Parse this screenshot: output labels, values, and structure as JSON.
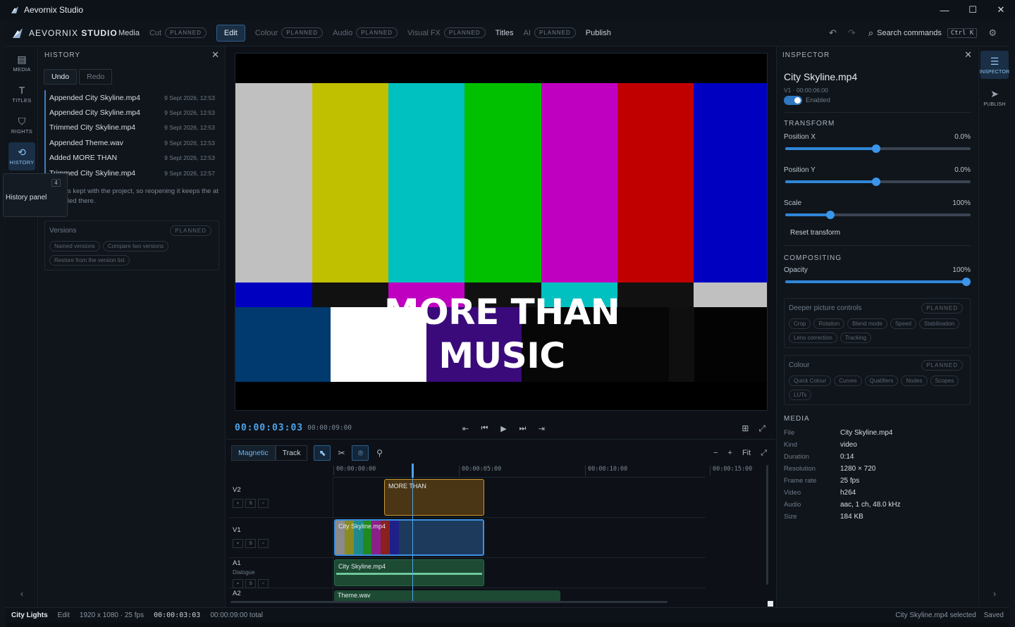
{
  "window": {
    "title": "Aevornix Studio",
    "minimize": "—",
    "maximize": "☐",
    "close": "✕"
  },
  "brand": {
    "prefix": "AEVORNIX",
    "suffix": "STUDIO"
  },
  "nav": [
    {
      "label": "Media",
      "badge": "",
      "state": "normal"
    },
    {
      "label": "Cut",
      "badge": "PLANNED",
      "state": "dim"
    },
    {
      "label": "Edit",
      "badge": "",
      "state": "active"
    },
    {
      "label": "Colour",
      "badge": "PLANNED",
      "state": "dim"
    },
    {
      "label": "Audio",
      "badge": "PLANNED",
      "state": "dim"
    },
    {
      "label": "Visual FX",
      "badge": "PLANNED",
      "state": "dim"
    },
    {
      "label": "Titles",
      "badge": "",
      "state": "normal"
    },
    {
      "label": "AI",
      "badge": "PLANNED",
      "state": "dim"
    },
    {
      "label": "Publish",
      "badge": "",
      "state": "normal"
    }
  ],
  "header": {
    "undo_icon": "↶",
    "redo_icon": "↷",
    "search_icon": "⌕",
    "search_label": "Search commands",
    "search_kbd": "Ctrl K",
    "settings_icon": "⚙"
  },
  "rail": [
    {
      "label": "MEDIA",
      "icon": "media-icon",
      "glyph": "▤"
    },
    {
      "label": "TITLES",
      "icon": "titles-icon",
      "glyph": "T"
    },
    {
      "label": "RIGHTS",
      "icon": "shield-icon",
      "glyph": "⛉"
    },
    {
      "label": "HISTORY",
      "icon": "history-icon",
      "glyph": "⟲"
    }
  ],
  "rail_bottom": "‹",
  "tooltip": {
    "kbd": "4",
    "text": "History panel"
  },
  "history": {
    "title": "HISTORY",
    "close": "✕",
    "undo": "Undo",
    "redo": "Redo",
    "items": [
      {
        "label": "Appended City Skyline.mp4",
        "time": "9 Sept 2026, 12:53"
      },
      {
        "label": "Appended City Skyline.mp4",
        "time": "9 Sept 2026, 12:53"
      },
      {
        "label": "Trimmed City Skyline.mp4",
        "time": "9 Sept 2026, 12:53"
      },
      {
        "label": "Appended Theme.wav",
        "time": "9 Sept 2026, 12:53"
      },
      {
        "label": "Added MORE THAN",
        "time": "9 Sept 2026, 12:53"
      },
      {
        "label": "Trimmed City Skyline.mp4",
        "time": "9 Sept 2026, 12:57"
      }
    ],
    "note": "s kept with the project, so reopening it keeps the at led there.",
    "versions": {
      "title": "Versions",
      "badge": "PLANNED",
      "pills": [
        "Named versions",
        "Compare two versions",
        "Restore from the version list"
      ]
    }
  },
  "viewer": {
    "title_line1": "MORE THAN",
    "title_line2": "MUSIC"
  },
  "transport": {
    "timecode": "00:00:03:03",
    "duration": "00:00:09:00",
    "controls": [
      "⇤",
      "⏮",
      "▶",
      "⏭",
      "⇥"
    ],
    "right": [
      "⊞",
      "⤢"
    ]
  },
  "timeline_toolbar": {
    "modes": [
      "Magnetic",
      "Track"
    ],
    "tools": [
      {
        "name": "select-tool-icon",
        "glyph": "⬉",
        "on": true
      },
      {
        "name": "razor-tool-icon",
        "glyph": "✂",
        "on": false
      },
      {
        "name": "snap-tool-icon",
        "glyph": "⌾",
        "on": true
      },
      {
        "name": "marker-tool-icon",
        "glyph": "⚲",
        "on": false
      }
    ],
    "zoom": [
      "−",
      "+",
      "Fit",
      "⤢"
    ]
  },
  "ruler": [
    "00:00:00:00",
    "00:00:05:00",
    "00:00:10:00",
    "00:00:15:00"
  ],
  "tracks": [
    {
      "name": "V2",
      "sub": "",
      "buttons": [
        "▪",
        "S",
        "▫"
      ]
    },
    {
      "name": "V1",
      "sub": "",
      "buttons": [
        "▪",
        "S",
        "▫"
      ]
    },
    {
      "name": "A1",
      "sub": "Dialogue",
      "buttons": [
        "▪",
        "S",
        "▫"
      ]
    },
    {
      "name": "A2",
      "sub": "",
      "buttons": []
    }
  ],
  "clips": {
    "v2": "MORE THAN",
    "v1": "City Skyline.mp4",
    "a1": "City Skyline.mp4",
    "a2": "Theme.wav"
  },
  "inspector": {
    "title": "INSPECTOR",
    "close": "✕",
    "clip_name": "City Skyline.mp4",
    "clip_meta": "V1 · 00:00:06:00",
    "enabled": "Enabled",
    "transform_title": "TRANSFORM",
    "position_x": {
      "label": "Position X",
      "value": "0.0%",
      "fraction": 0.5
    },
    "position_y": {
      "label": "Position Y",
      "value": "0.0%",
      "fraction": 0.5
    },
    "scale": {
      "label": "Scale",
      "value": "100%",
      "fraction": 0.25
    },
    "reset": "Reset transform",
    "compositing_title": "COMPOSITING",
    "opacity": {
      "label": "Opacity",
      "value": "100%",
      "fraction": 1.0
    },
    "deeper": {
      "title": "Deeper picture controls",
      "badge": "PLANNED",
      "pills": [
        "Crop",
        "Rotation",
        "Blend mode",
        "Speed",
        "Stabilisation",
        "Lens correction",
        "Tracking"
      ]
    },
    "colour": {
      "title": "Colour",
      "badge": "PLANNED",
      "pills": [
        "Quick Colour",
        "Curves",
        "Qualifiers",
        "Nodes",
        "Scopes",
        "LUTs"
      ]
    },
    "media_title": "MEDIA",
    "media": [
      {
        "k": "File",
        "v": "City Skyline.mp4"
      },
      {
        "k": "Kind",
        "v": "video"
      },
      {
        "k": "Duration",
        "v": "0:14"
      },
      {
        "k": "Resolution",
        "v": "1280 × 720"
      },
      {
        "k": "Frame rate",
        "v": "25 fps"
      },
      {
        "k": "Video",
        "v": "h264"
      },
      {
        "k": "Audio",
        "v": "aac, 1 ch, 48.0 kHz"
      },
      {
        "k": "Size",
        "v": "184 KB"
      }
    ]
  },
  "right_rail": [
    {
      "label": "INSPECTOR",
      "glyph": "☰"
    },
    {
      "label": "PUBLISH",
      "glyph": "➤"
    }
  ],
  "right_rail_bottom": "›",
  "status": {
    "project": "City Lights",
    "mode": "Edit",
    "format": "1920 x 1080 · 25 fps",
    "timecode": "00:00:03:03",
    "total": "00:00:09:00 total",
    "selection": "City Skyline.mp4 selected",
    "saved": "Saved"
  },
  "colors": {
    "accent": "#2f86d8",
    "active_bg": "#1a2f45"
  }
}
